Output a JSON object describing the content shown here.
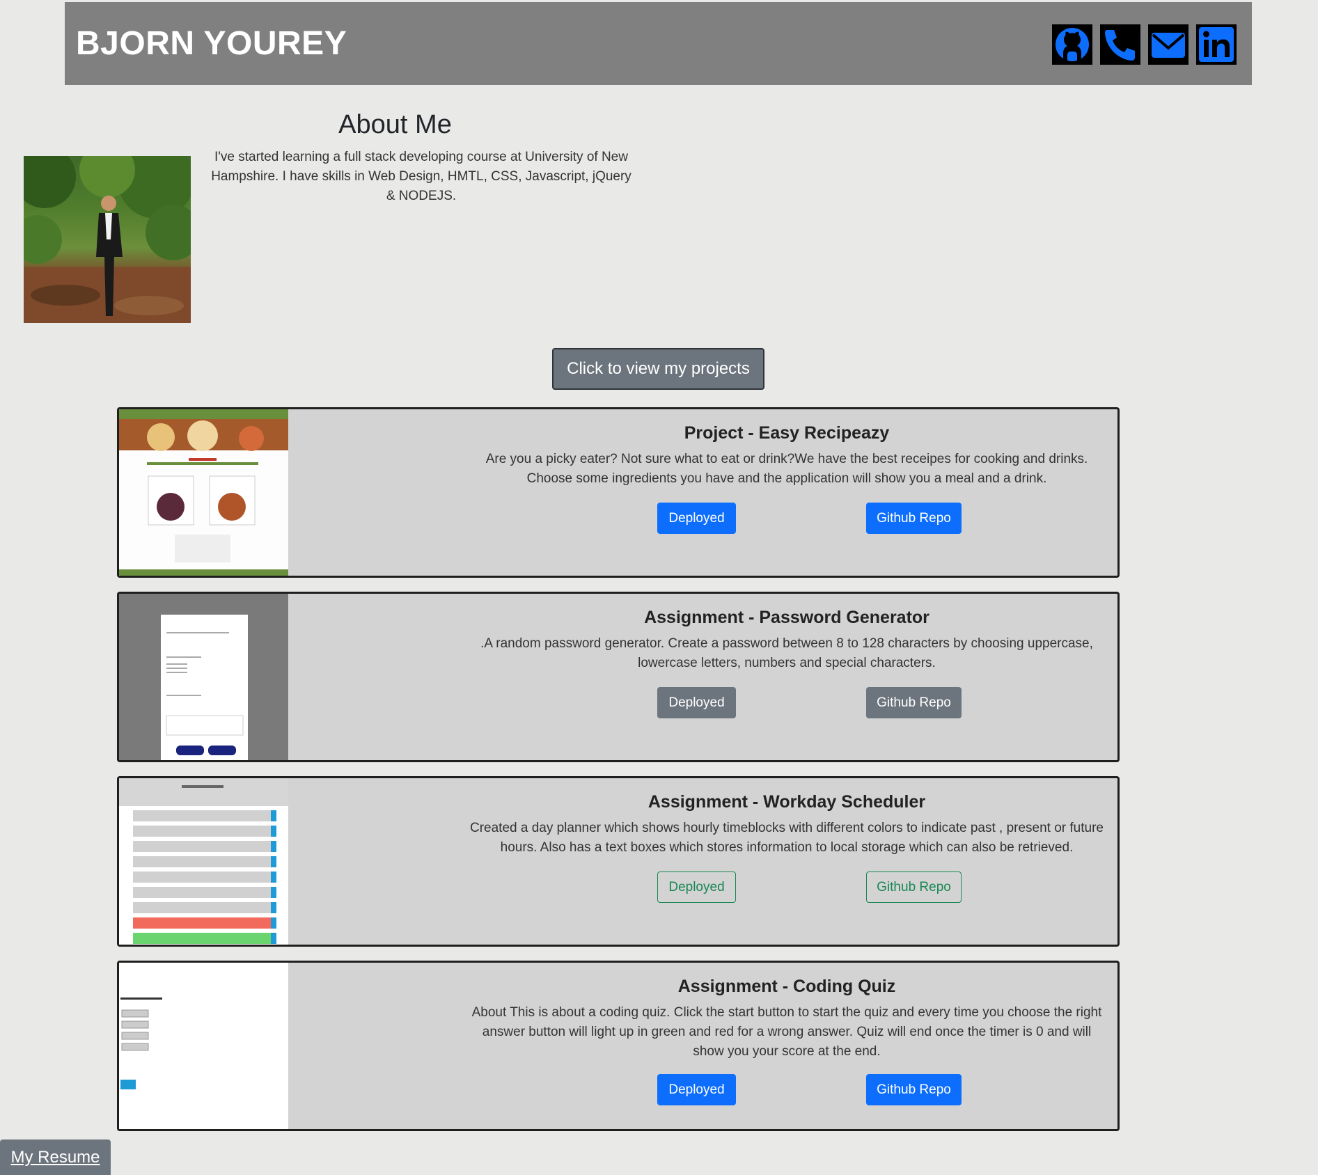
{
  "header": {
    "brand": "BJORN YOUREY",
    "icons": [
      "github-icon",
      "phone-icon",
      "email-icon",
      "linkedin-icon"
    ],
    "icon_color": "#0d6efd",
    "background": "#808080"
  },
  "about": {
    "title": "About Me",
    "text": "I've started learning a full stack developing course at University of New Hampshire. I have skills in Web Design, HMTL, CSS, Javascript, jQuery & NODEJS."
  },
  "projects_button": "Click to view my projects",
  "projects": [
    {
      "title": "Project - Easy Recipeazy",
      "description": "Are you a picky eater? Not sure what to eat or drink?We have the best receipes for cooking and drinks. Choose some ingredients you have and the application will show you a meal and a drink.",
      "deployed_label": "Deployed",
      "repo_label": "Github Repo",
      "button_style": "primary"
    },
    {
      "title": "Assignment - Password Generator",
      "description": ".A random password generator. Create a password between 8 to 128 characters by choosing uppercase, lowercase letters, numbers and special characters.",
      "deployed_label": "Deployed",
      "repo_label": "Github Repo",
      "button_style": "secondary"
    },
    {
      "title": "Assignment - Workday Scheduler",
      "description": "Created a day planner which shows hourly timeblocks with different colors to indicate past , present or future hours. Also has a text boxes which stores information to local storage which can also be retrieved.",
      "deployed_label": "Deployed",
      "repo_label": "Github Repo",
      "button_style": "outline-success"
    },
    {
      "title": "Assignment - Coding Quiz",
      "description": "About This is about a coding quiz. Click the start button to start the quiz and every time you choose the right answer button will light up in green and red for a wrong answer. Quiz will end once the timer is 0 and will show you your score at the end.",
      "deployed_label": "Deployed",
      "repo_label": "Github Repo",
      "button_style": "primary"
    }
  ],
  "resume_link": "My Resume"
}
